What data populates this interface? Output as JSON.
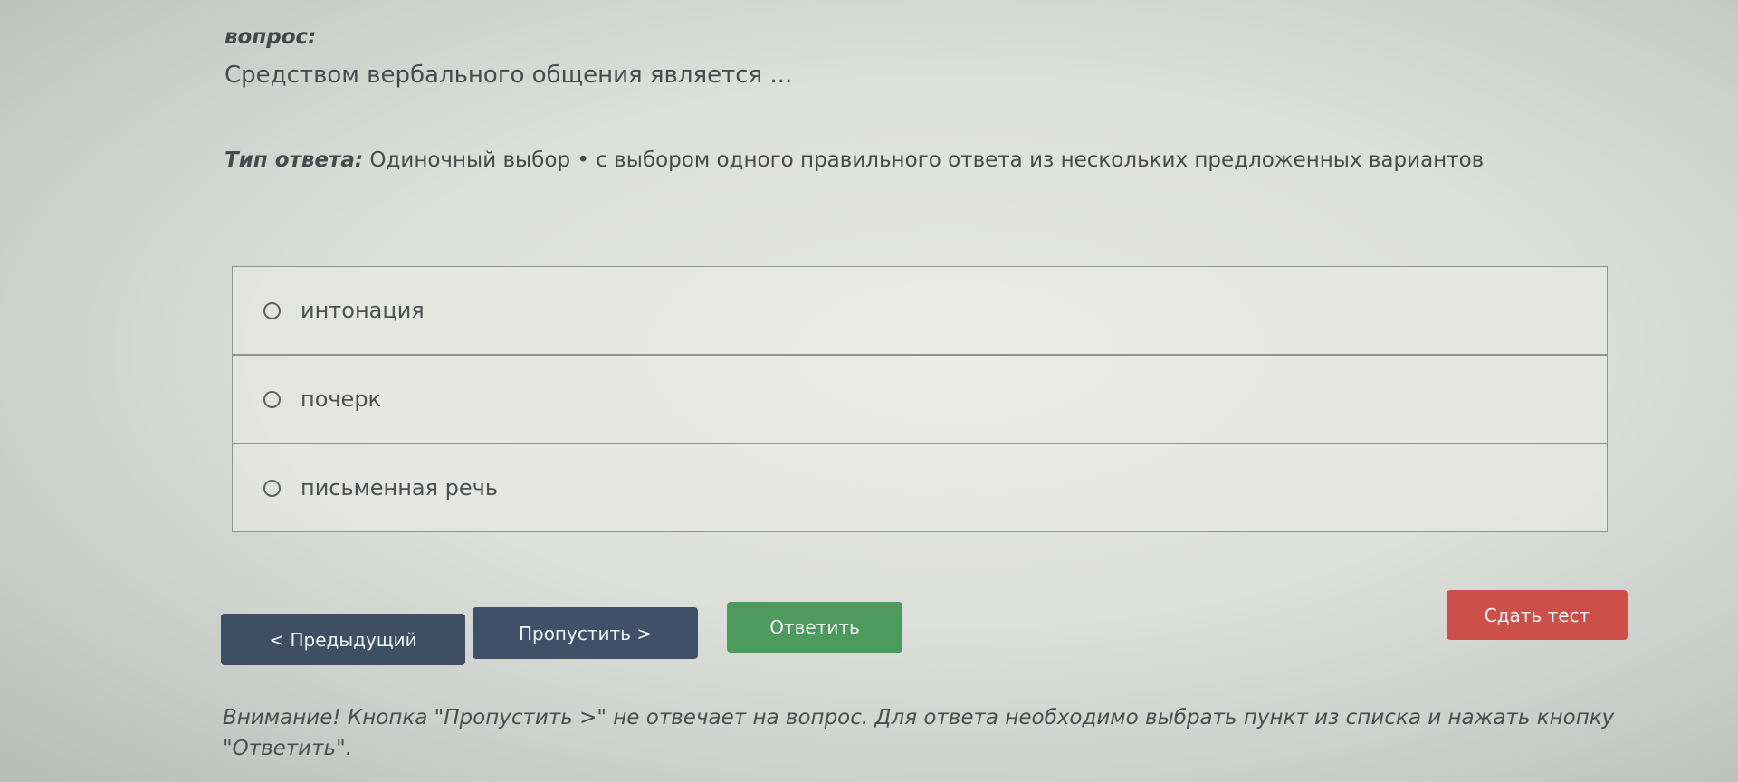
{
  "question": {
    "label": "вопрос:",
    "text": "Средством вербального общения является ..."
  },
  "answer_type": {
    "key": "Тип ответа:",
    "value": "Одиночный выбор • с выбором одного правильного ответа из нескольких предложенных вариантов"
  },
  "options": [
    {
      "label": "интонация"
    },
    {
      "label": "почерк"
    },
    {
      "label": "письменная речь"
    }
  ],
  "buttons": {
    "prev": "< Предыдущий",
    "skip": "Пропустить >",
    "answer": "Ответить",
    "submit": "Сдать тест"
  },
  "note": "Внимание! Кнопка \"Пропустить >\" не отвечает на вопрос. Для ответа необходимо выбрать пункт из списка и нажать кнопку \"Ответить\".",
  "colors": {
    "prev_button": "#3e4f63",
    "skip_button": "#3f5168",
    "answer_button": "#4c9a5c",
    "submit_button": "#cd4f4a"
  }
}
